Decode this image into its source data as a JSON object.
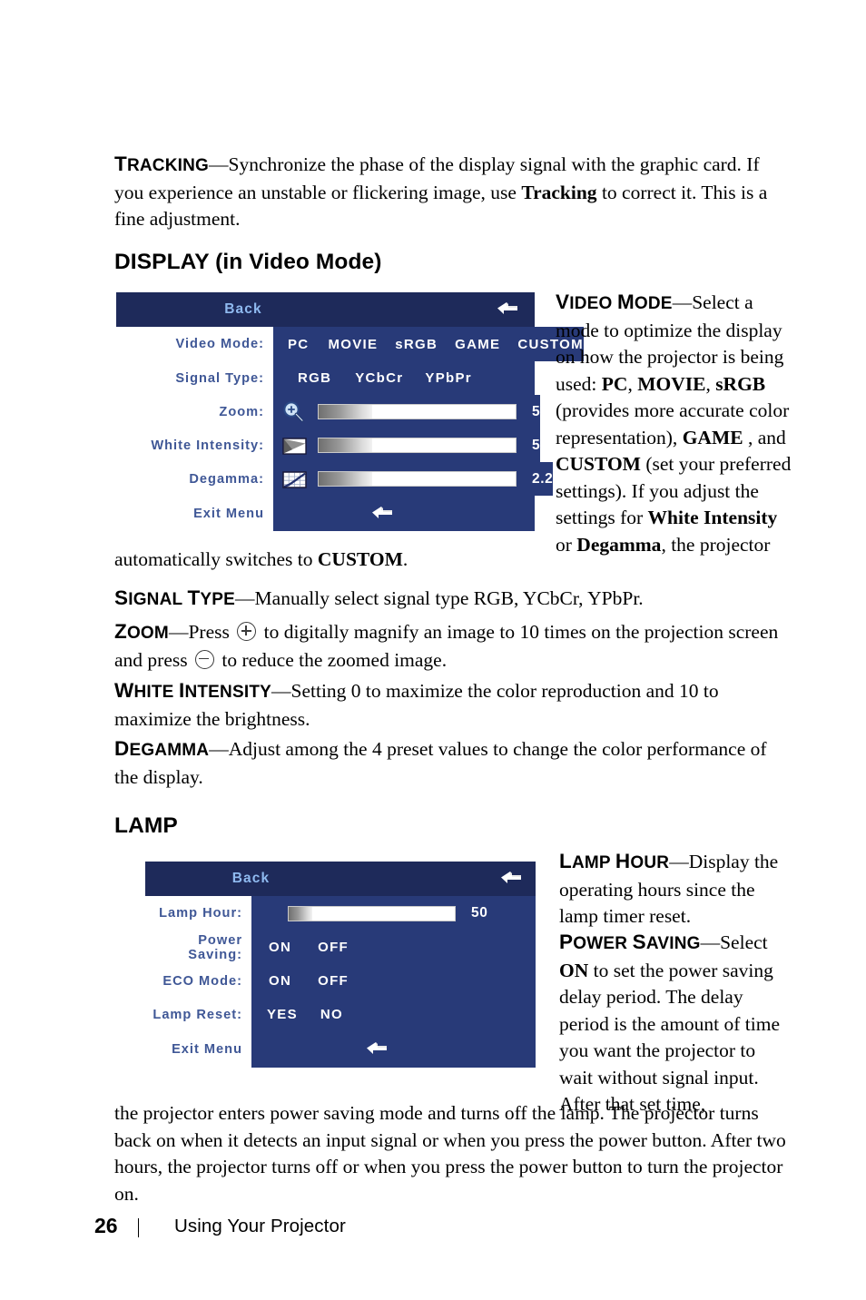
{
  "page": {
    "number": "26",
    "footer_title": "Using Your Projector"
  },
  "intro": {
    "term": "Tracking",
    "term_first": "T",
    "term_rest": "RACKING",
    "text_1": "—Synchronize the phase of the display signal with the graphic card. If you experience an unstable or flickering image, use ",
    "bold_1": "Tracking",
    "text_2": " to correct it. This is a fine adjustment."
  },
  "display_section": {
    "heading": "DISPLAY (in Video Mode)",
    "osd": {
      "back_label": "Back",
      "return_icon": "return-arrow-icon",
      "rows": [
        {
          "label": "Video Mode:",
          "type": "options",
          "options": [
            "PC",
            "MOVIE",
            "sRGB",
            "GAME",
            "CUSTOM"
          ]
        },
        {
          "label": "Signal Type:",
          "type": "options",
          "options": [
            "RGB",
            "YCbCr",
            "YPbPr"
          ]
        },
        {
          "label": "Zoom:",
          "type": "slider",
          "icon": "magnifier-plus-icon",
          "value": "5",
          "fill_percent": 27
        },
        {
          "label": "White Intensity:",
          "type": "slider",
          "icon": "white-intensity-icon",
          "value": "5",
          "fill_percent": 27
        },
        {
          "label": "Degamma:",
          "type": "slider",
          "icon": "degamma-curve-icon",
          "value": "2.2",
          "fill_percent": 27
        },
        {
          "label": "Exit Menu",
          "type": "exit",
          "icon": "return-arrow-icon"
        }
      ]
    },
    "video_mode": {
      "term_first": "V",
      "term_rest": "IDEO ",
      "term_first2": "M",
      "term_rest2": "ODE",
      "t1": "—Select a mode to optimize the display on how the projector is being used: ",
      "b1": "PC",
      "t2": ", ",
      "b2": "MOVIE",
      "t3": ", ",
      "b3": "sRGB",
      "t4": " (provides more accurate color representation), ",
      "b4": "GAME",
      "t5": " , and ",
      "b5": "CUSTOM",
      "t6": " (set your preferred settings). If you adjust the settings for ",
      "b6": "White Intensity",
      "t7": " or ",
      "b7": "Degamma",
      "t8": ", the projector"
    },
    "wrap_line": {
      "t1": "automatically switches to ",
      "b1": "CUSTOM",
      "t2": "."
    },
    "signal_type": {
      "term_first": "S",
      "term_rest": "IGNAL ",
      "term_first2": "T",
      "term_rest2": "YPE",
      "text": "—Manually select signal type RGB, YCbCr, YPbPr."
    },
    "zoom": {
      "term_first": "Z",
      "term_rest": "OOM",
      "t1": "—Press ",
      "icon1": "plus-button-icon",
      "t2": " to digitally magnify an image to 10 times on the projection screen and press ",
      "icon2": "minus-button-icon",
      "t3": " to reduce the zoomed image."
    },
    "white_intensity": {
      "term_first": "W",
      "term_rest": "HITE ",
      "term_first2": "I",
      "term_rest2": "NTENSITY",
      "text": "—Setting 0 to maximize the color reproduction and 10 to maximize the brightness."
    },
    "degamma": {
      "term_first": "D",
      "term_rest": "EGAMMA",
      "text": "—Adjust among the 4 preset values to change the color performance of the display."
    }
  },
  "lamp_section": {
    "heading": "LAMP",
    "osd": {
      "back_label": "Back",
      "return_icon": "return-arrow-icon",
      "rows": [
        {
          "label": "Lamp Hour:",
          "type": "slider",
          "value": "50",
          "fill_percent": 14
        },
        {
          "label": "Power Saving:",
          "type": "options",
          "options": [
            "ON",
            "OFF"
          ]
        },
        {
          "label": "ECO Mode:",
          "type": "options",
          "options": [
            "ON",
            "OFF"
          ]
        },
        {
          "label": "Lamp Reset:",
          "type": "options",
          "options": [
            "YES",
            "NO"
          ]
        },
        {
          "label": "Exit Menu",
          "type": "exit",
          "icon": "return-arrow-icon"
        }
      ]
    },
    "lamp_hour": {
      "term_first": "L",
      "term_rest": "AMP ",
      "term_first2": "H",
      "term_rest2": "OUR",
      "text": "—Display the operating hours since the lamp timer reset."
    },
    "power_saving": {
      "term_first": "P",
      "term_rest": "OWER ",
      "term_first2": "S",
      "term_rest2": "AVING",
      "t1": "—Select ",
      "b1": "ON",
      "t2": " to set the power saving delay period. The delay period is the amount of time you want the projector to wait without signal input. After that set time,"
    },
    "wrap_paragraph": "the projector enters power saving mode and turns off the lamp. The projector turns back on when it detects an input signal or when you press the power button. After two hours, the projector turns off or when you press the power button to turn the projector on."
  },
  "colors": {
    "osd_header_bg": "#1e2a5a",
    "osd_value_bg": "#283a78",
    "osd_label_text": "#3f5796",
    "osd_back_text": "#8fbaf0",
    "osd_option_text": "#ffffff"
  }
}
